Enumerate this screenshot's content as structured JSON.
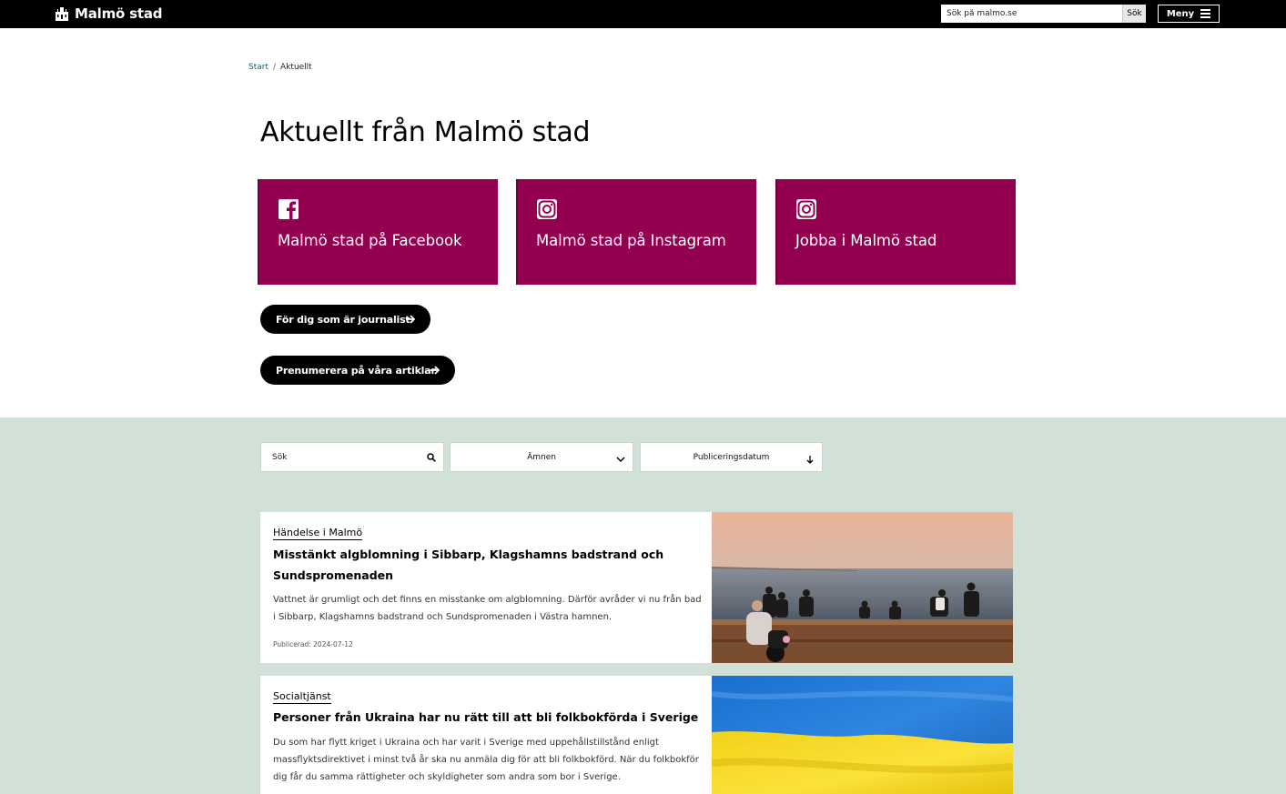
{
  "header": {
    "logo_text": "Malmö stad",
    "search_placeholder": "Sök på malmo.se",
    "search_button": "Sök",
    "menu_label": "Meny"
  },
  "breadcrumb": {
    "start": "Start",
    "separator": "/",
    "current": "Aktuellt"
  },
  "page": {
    "title": "Aktuellt från Malmö stad"
  },
  "cards": [
    {
      "label": "Malmö stad på Facebook",
      "icon": "facebook-icon"
    },
    {
      "label": "Malmö stad på Instagram",
      "icon": "instagram-icon"
    },
    {
      "label": "Jobba i Malmö stad",
      "icon": "instagram-icon"
    }
  ],
  "pills": [
    {
      "label": "För dig som är journalist"
    },
    {
      "label": "Prenumerera på våra artiklar"
    }
  ],
  "filters": {
    "search_placeholder": "Sök",
    "topics_label": "Ämnen",
    "sort_label": "Publiceringsdatum"
  },
  "articles": [
    {
      "category": "Händelse i Malmö",
      "title": "Misstänkt algblomning i Sibbarp, Klagshamns badstrand och Sundspromenaden",
      "body": "Vattnet är grumligt och det finns en misstanke om algblomning. Därför avråder vi nu från bad i Sibbarp, Klagshamns badstrand och Sundspromenaden i Västra hamnen.",
      "date": "Publicerad: 2024-07-12"
    },
    {
      "category": "Socialtjänst",
      "title": "Personer från Ukraina har nu rätt till att bli folkbokförda i Sverige",
      "body": "Du som har flytt kriget i Ukraina och har varit i Sverige med uppehållstillstånd enligt massflyktsdirektivet i minst två år ska nu anmäla dig för att bli folkbokförd. När du folkbokför dig får du samma rättigheter och skyldigheter som andra som bor i Sverige."
    }
  ],
  "colors": {
    "brand_magenta": "#930050",
    "section_green": "#d1e1d7",
    "link_blue": "#006c8a"
  }
}
